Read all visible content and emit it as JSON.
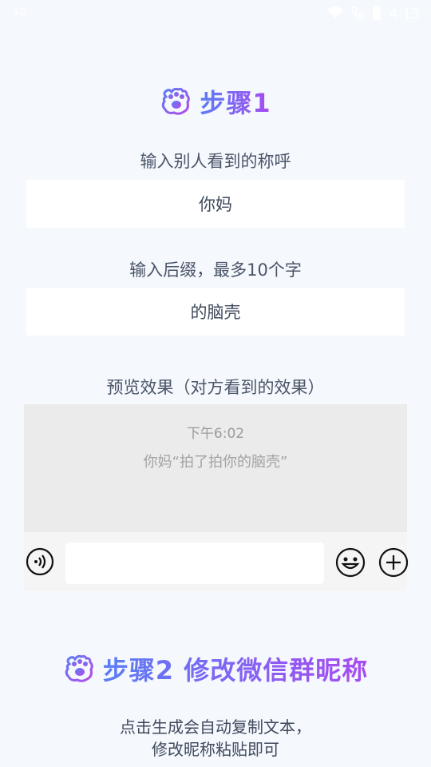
{
  "status_bar": {
    "left": "4G",
    "time": "4:13"
  },
  "step1": {
    "title": "步骤1",
    "icon": "paw-icon"
  },
  "nickname": {
    "label": "输入别人看到的称呼",
    "value": "你妈"
  },
  "suffix": {
    "label": "输入后缀，最多10个字",
    "value": "的脑壳"
  },
  "preview": {
    "label": "预览效果（对方看到的效果）",
    "time": "下午6:02",
    "message": "你妈“拍了拍你的脑壳”"
  },
  "step2": {
    "title": "步骤2 修改微信群昵称",
    "icon": "paw-icon"
  },
  "instructions": {
    "line1": "点击生成会自动复制文本，",
    "line2": "修改昵称粘贴即可"
  },
  "colors": {
    "gradient_start": "#5b7df5",
    "gradient_end": "#a84bf0",
    "background": "#f5f8fd"
  }
}
